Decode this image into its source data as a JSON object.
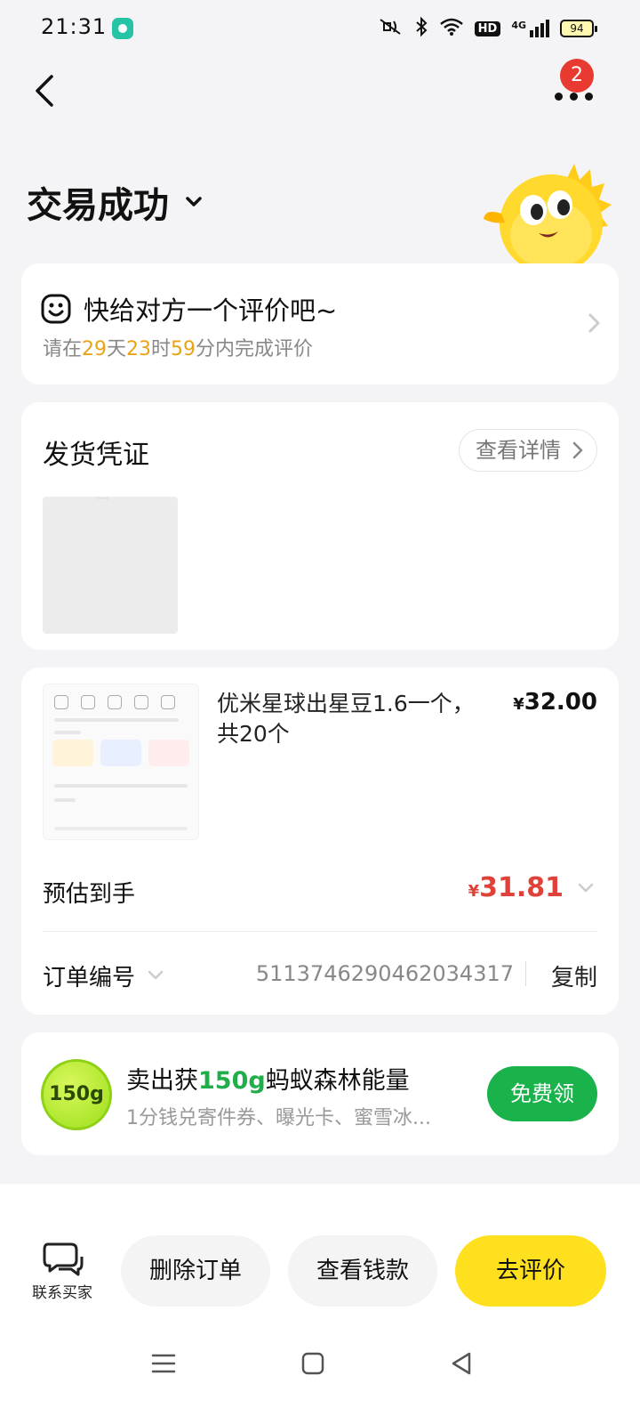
{
  "status_bar": {
    "time": "21:31",
    "network": "4G",
    "hd": "HD",
    "battery": "94"
  },
  "header": {
    "notification_count": "2",
    "title": "交易成功"
  },
  "review": {
    "title": "快给对方一个评价吧~",
    "sub_prefix": "请在",
    "days": "29",
    "day_unit": "天",
    "hours": "23",
    "hour_unit": "时",
    "minutes": "59",
    "minute_unit": "分内完成评价"
  },
  "proof": {
    "title": "发货凭证",
    "detail_label": "查看详情"
  },
  "order": {
    "name": "优米星球出星豆1.6一个，共20个",
    "price_symbol": "¥",
    "price": "32.00",
    "estimated_label": "预估到手",
    "estimated_symbol": "¥",
    "estimated_value": "31.81",
    "order_no_label": "订单编号",
    "order_no": "5113746290462034317",
    "copy_label": "复制"
  },
  "energy": {
    "badge": "150g",
    "title_prefix": "卖出获",
    "title_amount": "150g",
    "title_suffix": "蚂蚁森林能量",
    "subtitle": "1分钱兑寄件券、曝光卡、蜜雪冰...",
    "button_label": "免费领"
  },
  "actions": {
    "contact_label": "联系买家",
    "delete_label": "删除订单",
    "money_label": "查看钱款",
    "review_label": "去评价"
  },
  "colors": {
    "accent_yellow": "#ffe01e",
    "price_red": "#e0423a",
    "green": "#1ab24b",
    "highlight_orange": "#e8a317"
  }
}
